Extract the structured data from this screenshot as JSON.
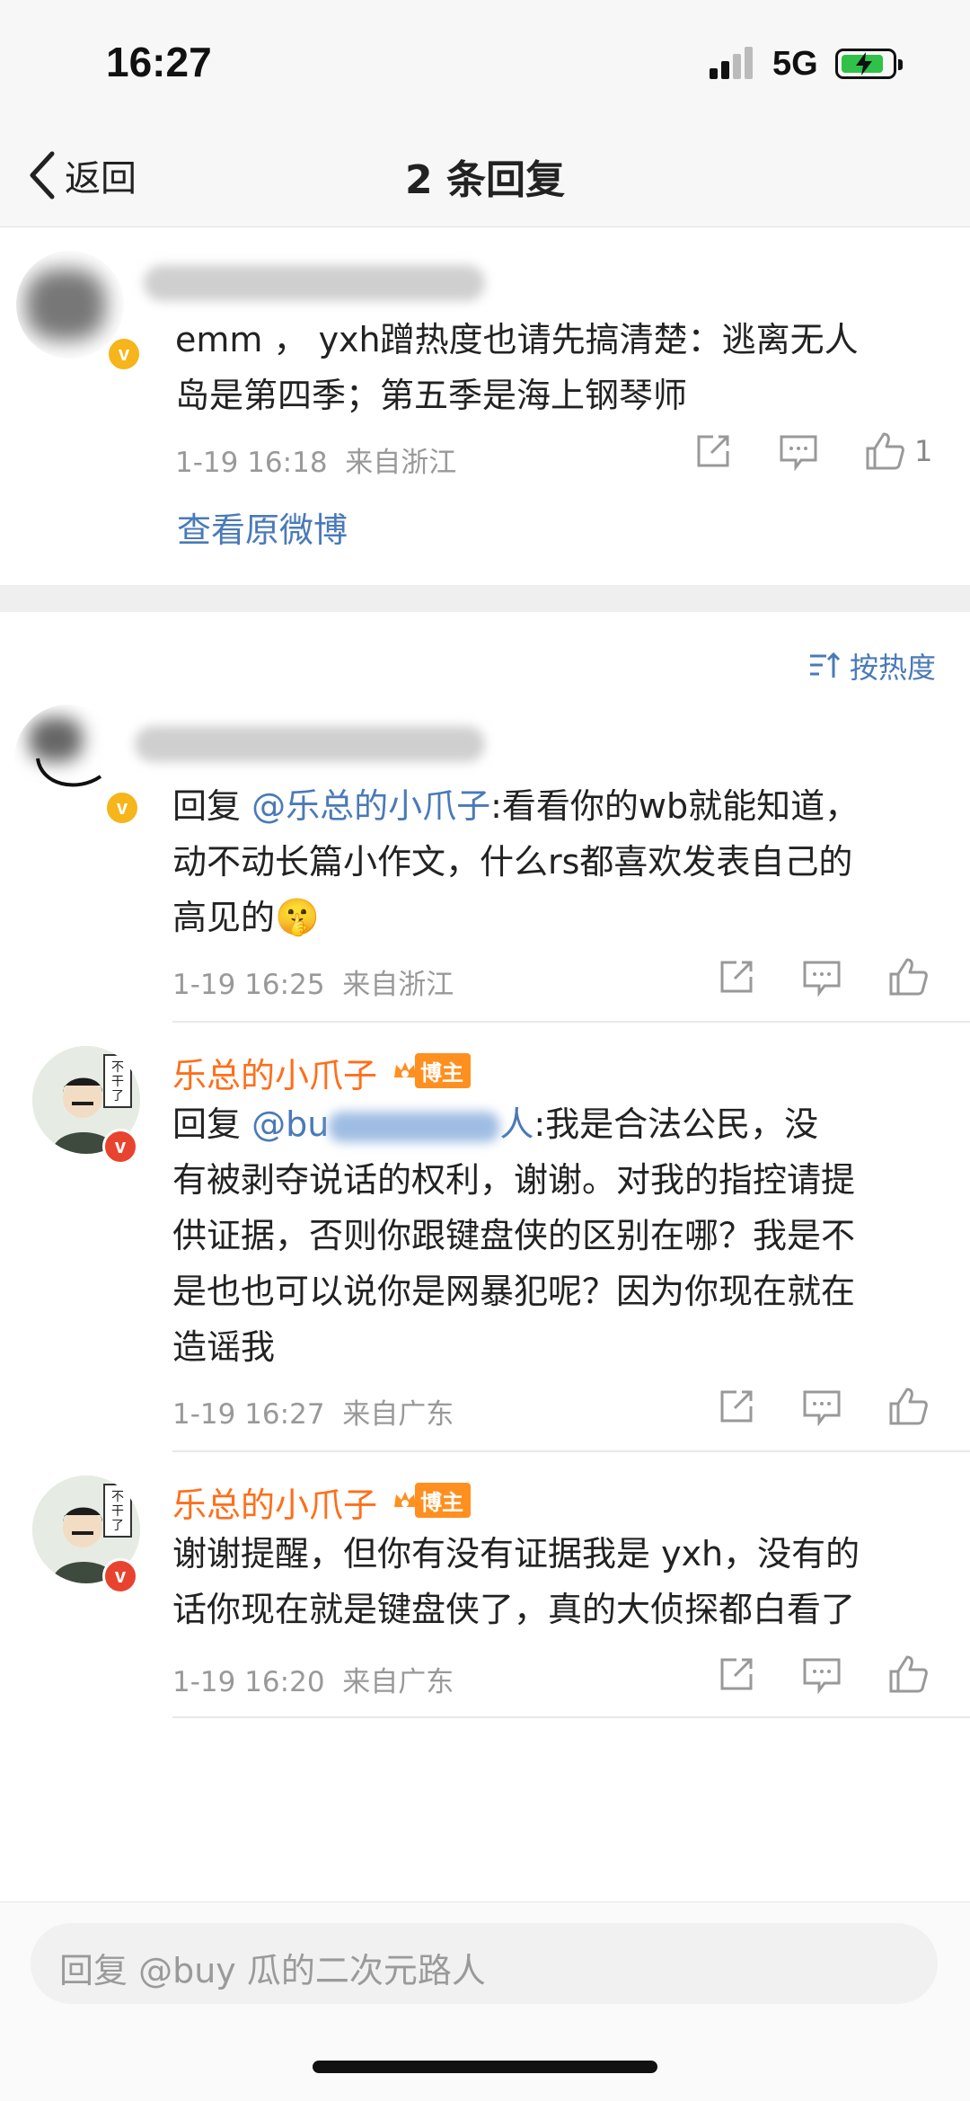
{
  "status": {
    "time": "16:27",
    "network": "5G"
  },
  "nav": {
    "back_label": "返回",
    "title": "2 条回复"
  },
  "original": {
    "text_line1": "emm ， yxh蹭热度也请先搞清楚：逃离无人",
    "text_line2": "岛是第四季；第五季是海上钢琴师",
    "time": "1-19 16:18",
    "location": "来自浙江",
    "like_count": "1",
    "view_original": "查看原微博"
  },
  "sort_label": "按热度",
  "replies": [
    {
      "prefix": "回复 ",
      "mention": "@乐总的小爪子",
      "line1_rest": ":看看你的wb就能知道，",
      "line2": "动不动长篇小作文，什么rs都喜欢发表自己的",
      "line3": "高见的",
      "emoji": "🤫",
      "time": "1-19 16:25",
      "location": "来自浙江"
    },
    {
      "username": "乐总的小爪子",
      "badge": "博主",
      "prefix": "回复 ",
      "mention_visible_start": "@bu",
      "mention_visible_end": "人",
      "line1_rest": ":我是合法公民，没",
      "line2": "有被剥夺说话的权利，谢谢。对我的指控请提",
      "line3": "供证据，否则你跟键盘侠的区别在哪？我是不",
      "line4": "是也也可以说你是网暴犯呢？因为你现在就在",
      "line5": "造谣我",
      "time": "1-19 16:27",
      "location": "来自广东"
    },
    {
      "username": "乐总的小爪子",
      "badge": "博主",
      "line1": "谢谢提醒，但你有没有证据我是 yxh，没有的",
      "line2": "话你现在就是键盘侠了，真的大侦探都白看了",
      "time": "1-19 16:20",
      "location": "来自广东"
    }
  ],
  "bottom": {
    "reply_placeholder": "回复 @buy 瓜的二次元路人"
  },
  "colors": {
    "link": "#4a7ab8",
    "username": "#ff6e1a",
    "verified_gold": "#f5b51b",
    "verified_red": "#e8432f"
  }
}
